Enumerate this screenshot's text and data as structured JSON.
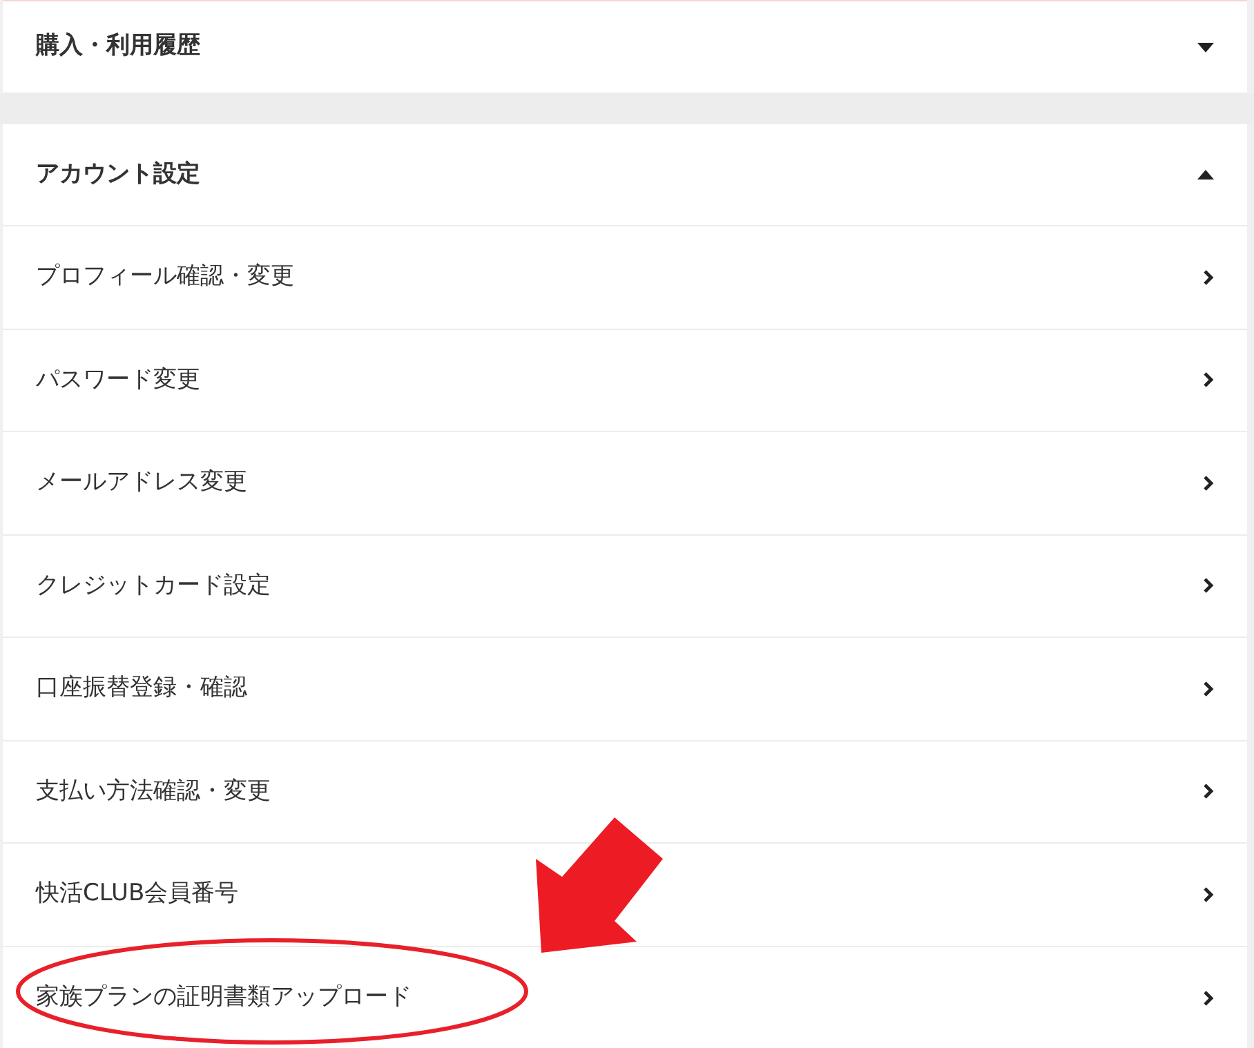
{
  "sections": [
    {
      "title": "購入・利用履歴",
      "expanded": false
    },
    {
      "title": "アカウント設定",
      "expanded": true,
      "items": [
        {
          "label": "プロフィール確認・変更"
        },
        {
          "label": "パスワード変更"
        },
        {
          "label": "メールアドレス変更"
        },
        {
          "label": "クレジットカード設定"
        },
        {
          "label": "口座振替登録・確認"
        },
        {
          "label": "支払い方法確認・変更"
        },
        {
          "label": "快活CLUB会員番号"
        },
        {
          "label": "家族プランの証明書類アップロード"
        }
      ]
    }
  ]
}
